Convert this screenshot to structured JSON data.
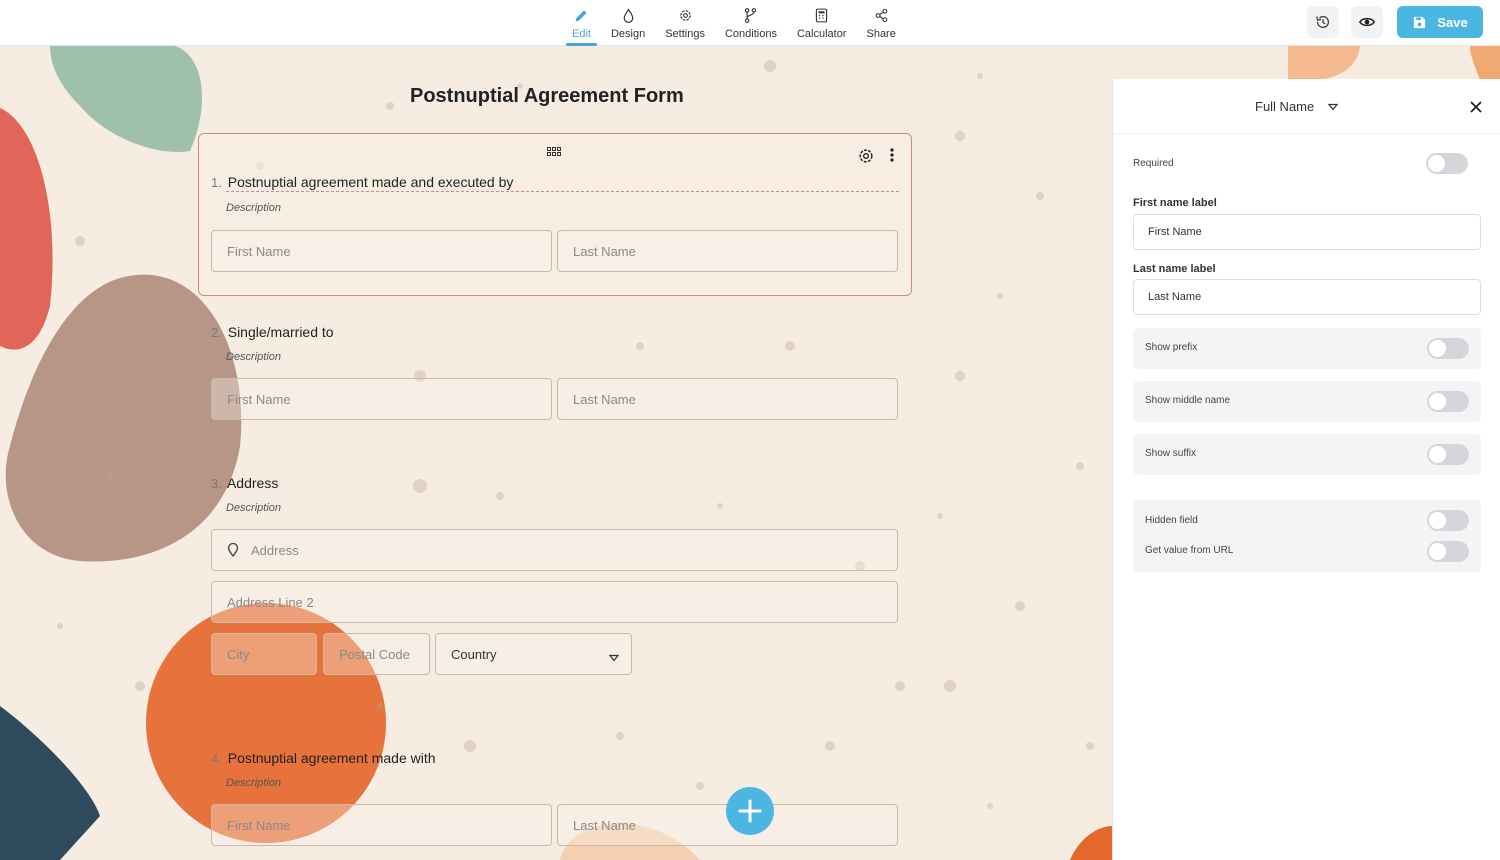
{
  "nav": [
    {
      "label": "Edit",
      "icon": "pencil-icon",
      "active": true
    },
    {
      "label": "Design",
      "icon": "droplet-icon",
      "active": false
    },
    {
      "label": "Settings",
      "icon": "gear-icon",
      "active": false
    },
    {
      "label": "Conditions",
      "icon": "branch-icon",
      "active": false
    },
    {
      "label": "Calculator",
      "icon": "calculator-icon",
      "active": false
    },
    {
      "label": "Share",
      "icon": "share-icon",
      "active": false
    }
  ],
  "toolbar": {
    "save_label": "Save",
    "history_icon": "history-icon",
    "preview_icon": "eye-icon"
  },
  "form": {
    "title": "Postnuptial Agreement Form",
    "questions": [
      {
        "number": "1.",
        "label": "Postnuptial agreement made and executed by",
        "description": "Description",
        "first_placeholder": "First Name",
        "last_placeholder": "Last Name"
      },
      {
        "number": "2.",
        "label": "Single/married to",
        "description": "Description",
        "first_placeholder": "First Name",
        "last_placeholder": "Last Name"
      },
      {
        "number": "3.",
        "label": "Address",
        "description": "Description",
        "address_placeholder": "Address",
        "address2_placeholder": "Address Line 2",
        "city_placeholder": "City",
        "postal_placeholder": "Postal Code",
        "country_value": "Country"
      },
      {
        "number": "4.",
        "label": "Postnuptial agreement made with",
        "description": "Description",
        "first_placeholder": "First Name",
        "last_placeholder": "Last Name"
      }
    ]
  },
  "panel": {
    "title": "Full Name",
    "required_label": "Required",
    "first_name_label_caption": "First name label",
    "first_name_label_value": "First Name",
    "last_name_label_caption": "Last name label",
    "last_name_label_value": "Last Name",
    "show_prefix": "Show prefix",
    "show_middle_name": "Show middle name",
    "show_suffix": "Show suffix",
    "hidden_field": "Hidden field",
    "get_value_from_url": "Get value from URL"
  },
  "colors": {
    "accent": "#4cb6e3",
    "card_border": "#c98f78",
    "background": "#f6ece2"
  }
}
